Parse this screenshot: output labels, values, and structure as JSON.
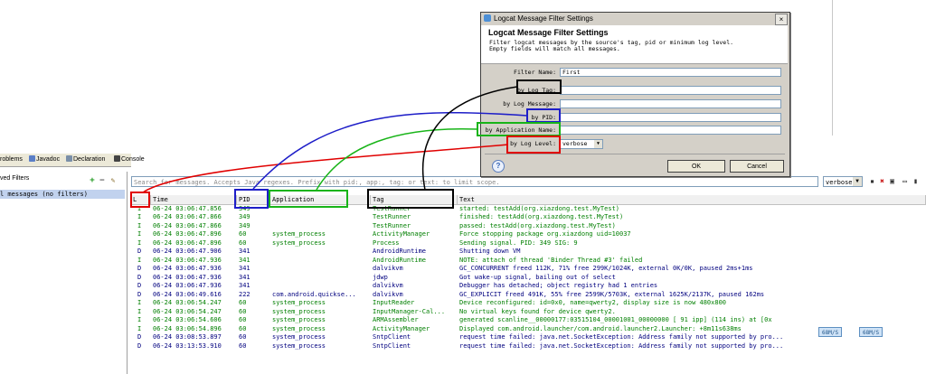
{
  "view_tabs": [
    "roblems",
    "Javadoc",
    "Declaration",
    "Console"
  ],
  "filters_panel": {
    "title": "ved Filters",
    "items": [
      "l messages (no filters)"
    ]
  },
  "logcat": {
    "search_placeholder": "Search for messages. Accepts Java regexes. Prefix with pid:, app:, tag: or text: to limit scope.",
    "level": "verbose",
    "columns": [
      "L",
      "Time",
      "PID",
      "Application",
      "Tag",
      "Text"
    ],
    "rows": [
      {
        "level": "I",
        "time": "06-24 03:06:47.856",
        "pid": "349",
        "app": "",
        "tag": "TestRunner",
        "text": "started: testAdd(org.xiazdong.test.MyTest)"
      },
      {
        "level": "I",
        "time": "06-24 03:06:47.866",
        "pid": "349",
        "app": "",
        "tag": "TestRunner",
        "text": "finished: testAdd(org.xiazdong.test.MyTest)"
      },
      {
        "level": "I",
        "time": "06-24 03:06:47.866",
        "pid": "349",
        "app": "",
        "tag": "TestRunner",
        "text": "passed: testAdd(org.xiazdong.test.MyTest)"
      },
      {
        "level": "I",
        "time": "06-24 03:06:47.896",
        "pid": "60",
        "app": "system_process",
        "tag": "ActivityManager",
        "text": "Force stopping package org.xiazdong uid=10037"
      },
      {
        "level": "I",
        "time": "06-24 03:06:47.896",
        "pid": "60",
        "app": "system_process",
        "tag": "Process",
        "text": "Sending signal. PID: 349 SIG: 9"
      },
      {
        "level": "D",
        "time": "06-24 03:06:47.906",
        "pid": "341",
        "app": "",
        "tag": "AndroidRuntime",
        "text": "Shutting down VM"
      },
      {
        "level": "I",
        "time": "06-24 03:06:47.936",
        "pid": "341",
        "app": "",
        "tag": "AndroidRuntime",
        "text": "NOTE: attach of thread 'Binder Thread #3' failed"
      },
      {
        "level": "D",
        "time": "06-24 03:06:47.936",
        "pid": "341",
        "app": "",
        "tag": "dalvikvm",
        "text": "GC_CONCURRENT freed 112K, 71% free 299K/1024K, external 0K/0K, paused 2ms+1ms"
      },
      {
        "level": "D",
        "time": "06-24 03:06:47.936",
        "pid": "341",
        "app": "",
        "tag": "jdwp",
        "text": "Got wake-up signal, bailing out of select"
      },
      {
        "level": "D",
        "time": "06-24 03:06:47.936",
        "pid": "341",
        "app": "",
        "tag": "dalvikvm",
        "text": "Debugger has detached; object registry had 1 entries"
      },
      {
        "level": "D",
        "time": "06-24 03:06:49.616",
        "pid": "222",
        "app": "com.android.quickse...",
        "tag": "dalvikvm",
        "text": "GC_EXPLICIT freed 491K, 55% free 2599K/5703K, external 1625K/2137K, paused 162ms"
      },
      {
        "level": "I",
        "time": "06-24 03:06:54.247",
        "pid": "60",
        "app": "system_process",
        "tag": "InputReader",
        "text": "Device reconfigured: id=0x0, name=qwerty2, display size is now 480x800"
      },
      {
        "level": "I",
        "time": "06-24 03:06:54.247",
        "pid": "60",
        "app": "system_process",
        "tag": "InputManager-Cal...",
        "text": "No virtual keys found for device qwerty2."
      },
      {
        "level": "I",
        "time": "06-24 03:06:54.606",
        "pid": "60",
        "app": "system_process",
        "tag": "ARMAssembler",
        "text": "generated scanline__00000177:03515104_00001001_00000000 [ 91 ipp] (114 ins) at [0x"
      },
      {
        "level": "I",
        "time": "06-24 03:06:54.896",
        "pid": "60",
        "app": "system_process",
        "tag": "ActivityManager",
        "text": "Displayed com.android.launcher/com.android.launcher2.Launcher: +8m11s638ms"
      },
      {
        "level": "D",
        "time": "06-24 03:08:53.897",
        "pid": "60",
        "app": "system_process",
        "tag": "SntpClient",
        "text": "request time failed: java.net.SocketException: Address family not supported by pro..."
      },
      {
        "level": "D",
        "time": "06-24 03:13:53.910",
        "pid": "60",
        "app": "system_process",
        "tag": "SntpClient",
        "text": "request time failed: java.net.SocketException: Address family not supported by pro..."
      }
    ]
  },
  "status_chips": [
    "68M/S",
    "68M/S"
  ],
  "dialog": {
    "title": "Logcat Message Filter Settings",
    "close": "×",
    "heading": "Logcat Message Filter Settings",
    "description_line1": "Filter logcat messages by the source's tag, pid or minimum log level.",
    "description_line2": "Empty fields will match all messages.",
    "labels": {
      "filter_name": "Filter Name:",
      "by_tag": "by Log Tag:",
      "by_message": "by Log Message:",
      "by_pid": "by PID:",
      "by_app": "by Application Name:",
      "by_level": "by Log Level:"
    },
    "values": {
      "filter_name": "First",
      "by_tag": "",
      "by_message": "",
      "by_pid": "",
      "by_app": "",
      "by_level": "verbose"
    },
    "help": "?",
    "ok": "OK",
    "cancel": "Cancel"
  },
  "annotation_colors": {
    "black": "#000000",
    "blue": "#1e1ec8",
    "green": "#18b418",
    "red": "#e00000"
  }
}
